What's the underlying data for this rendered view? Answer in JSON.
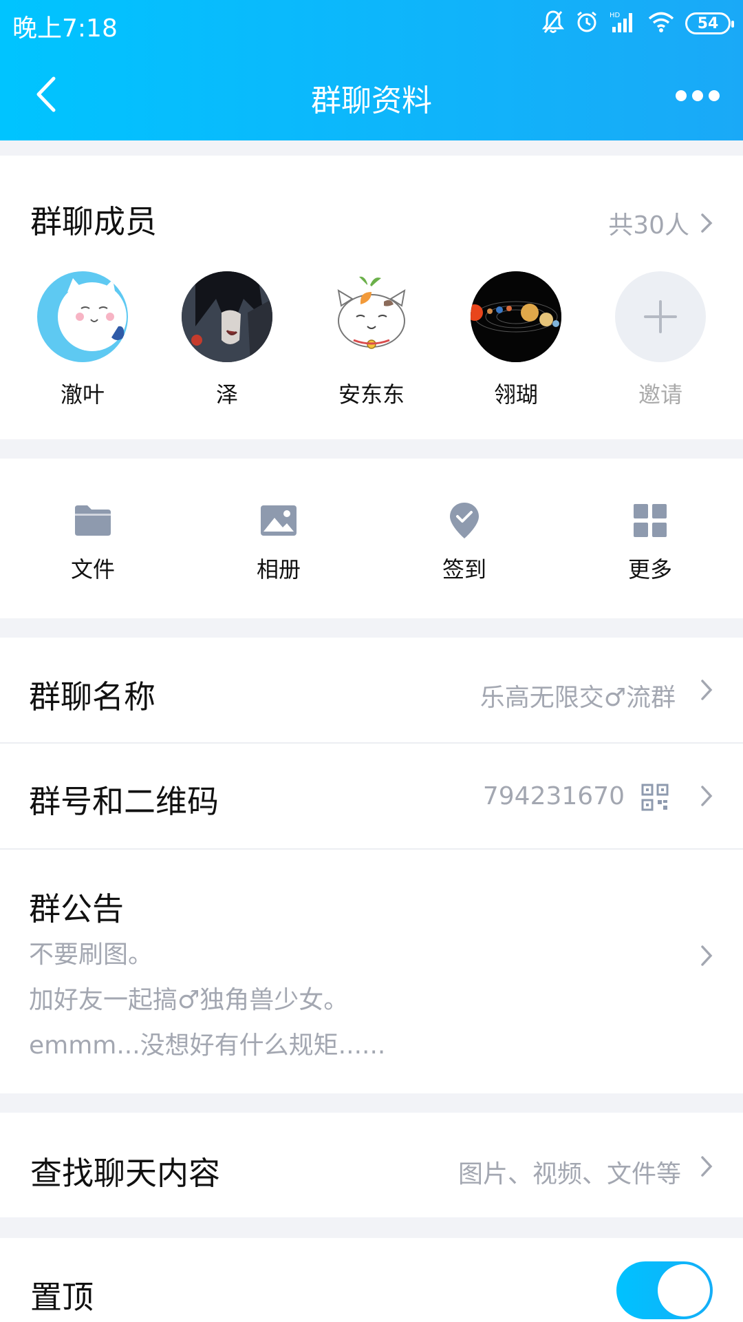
{
  "status_bar": {
    "time": "晚上7:18",
    "battery": "54"
  },
  "nav": {
    "title": "群聊资料"
  },
  "members": {
    "title": "群聊成员",
    "count": "共30人",
    "items": [
      {
        "name": "澈叶",
        "icon": "lucky-cat-avatar"
      },
      {
        "name": "泽",
        "icon": "anime-character-avatar"
      },
      {
        "name": "安东东",
        "icon": "cat-with-sprout-avatar"
      },
      {
        "name": "翎瑚",
        "icon": "solar-system-avatar"
      },
      {
        "name": "邀请",
        "icon": "plus-icon"
      }
    ]
  },
  "tools": [
    {
      "label": "文件",
      "icon": "folder-icon"
    },
    {
      "label": "相册",
      "icon": "image-icon"
    },
    {
      "label": "签到",
      "icon": "location-check-icon"
    },
    {
      "label": "更多",
      "icon": "grid-icon"
    }
  ],
  "group_name": {
    "label": "群聊名称",
    "value": "乐高无限交♂流群"
  },
  "group_id": {
    "label": "群号和二维码",
    "value": "794231670"
  },
  "announcement": {
    "label": "群公告",
    "lines": [
      "不要刷图。",
      "加好友一起搞♂独角兽少女。",
      "emmm...没想好有什么规矩......"
    ]
  },
  "search": {
    "label": "查找聊天内容",
    "value": "图片、视频、文件等"
  },
  "pin": {
    "label": "置顶",
    "enabled": true
  },
  "colors": {
    "accent": "#12b7f5",
    "muted": "#a3a7b1",
    "background": "#f2f3f7"
  }
}
